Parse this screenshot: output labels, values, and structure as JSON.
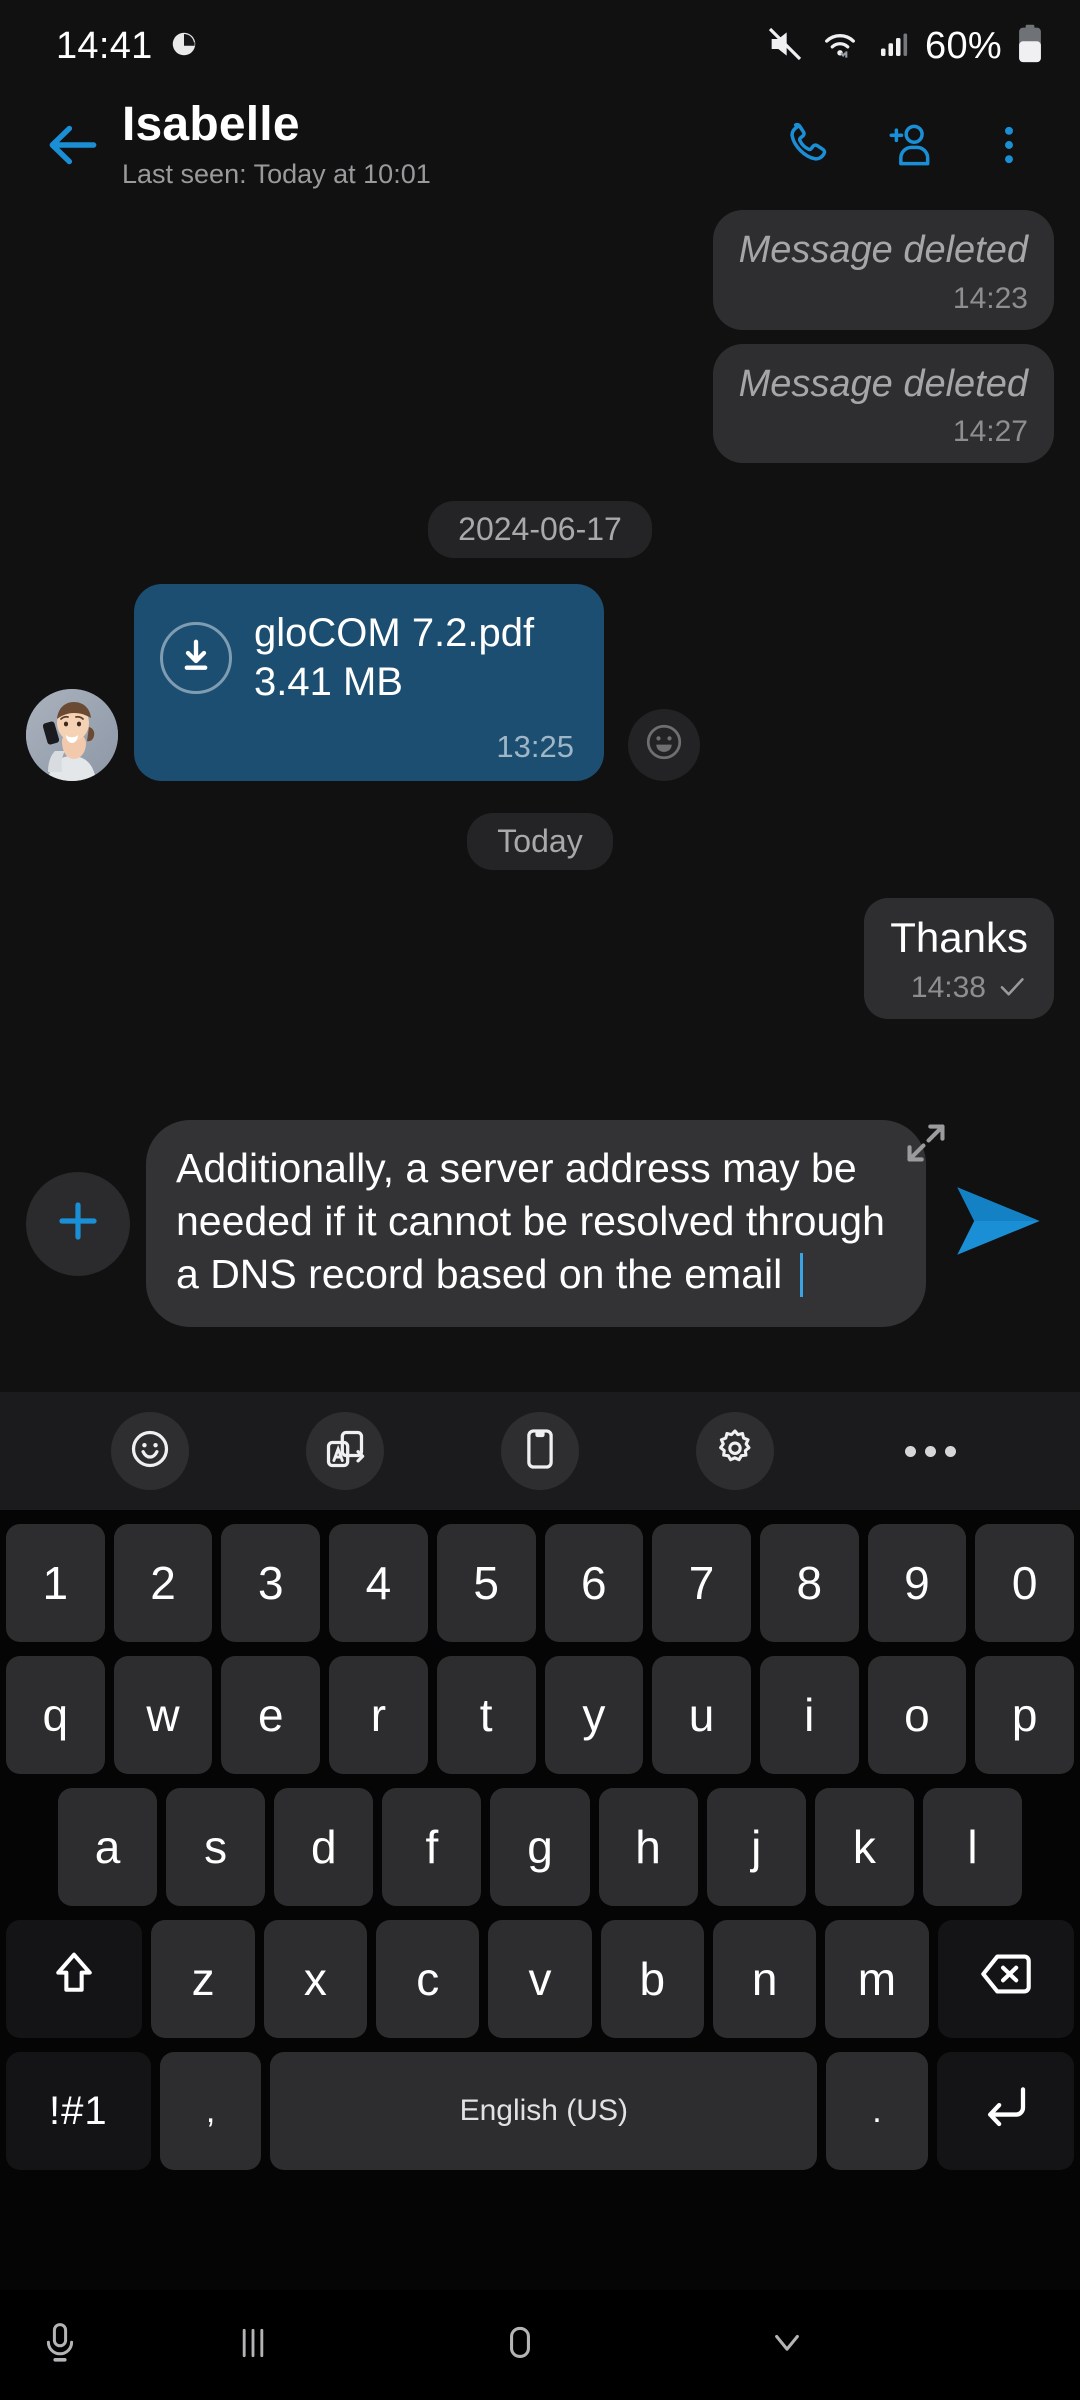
{
  "status_bar": {
    "time": "14:41",
    "left_icons": [
      "app-notification-icon"
    ],
    "right_icons": [
      "mute-icon",
      "wifi-icon",
      "signal-icon"
    ],
    "battery_percent": "60%"
  },
  "header": {
    "back_icon": "back-arrow-icon",
    "title": "Isabelle",
    "subtitle": "Last seen: Today at 10:01",
    "actions": [
      {
        "icon": "phone-icon",
        "name": "call-button"
      },
      {
        "icon": "add-person-icon",
        "name": "add-contact-button"
      },
      {
        "icon": "more-vertical-icon",
        "name": "overflow-menu-button"
      }
    ],
    "accent_color": "#1a8fd6"
  },
  "messages": [
    {
      "type": "deleted",
      "side": "out",
      "text": "Message deleted",
      "time": "14:23"
    },
    {
      "type": "deleted",
      "side": "out",
      "text": "Message deleted",
      "time": "14:27"
    },
    {
      "type": "date",
      "label": "2024-06-17"
    },
    {
      "type": "file",
      "side": "in",
      "file_name": "gloCOM 7.2.pdf",
      "file_size": "3.41 MB",
      "time": "13:25",
      "download_icon": "download-icon",
      "reaction_icon": "emoji-reaction-icon",
      "bubble_color": "#1c4e71"
    },
    {
      "type": "date",
      "label": "Today"
    },
    {
      "type": "text",
      "side": "out",
      "text": "Thanks",
      "time": "14:38",
      "status_icon": "sent-check-icon"
    }
  ],
  "composer": {
    "attach_icon": "plus-icon",
    "input_value": "Additionally, a server address may be needed if it cannot be resolved through a DNS record based on the email ",
    "expand_icon": "expand-icon",
    "send_icon": "send-icon"
  },
  "keyboard": {
    "toolbar": [
      {
        "icon": "emoji-icon",
        "name": "emoji-button"
      },
      {
        "icon": "translate-icon",
        "name": "translate-button"
      },
      {
        "icon": "clipboard-icon",
        "name": "clipboard-button"
      },
      {
        "icon": "gear-icon",
        "name": "keyboard-settings-button"
      },
      {
        "icon": "more-horizontal-icon",
        "name": "keyboard-more-button"
      }
    ],
    "rows": {
      "numbers": [
        "1",
        "2",
        "3",
        "4",
        "5",
        "6",
        "7",
        "8",
        "9",
        "0"
      ],
      "top": [
        "q",
        "w",
        "e",
        "r",
        "t",
        "y",
        "u",
        "i",
        "o",
        "p"
      ],
      "home": [
        "a",
        "s",
        "d",
        "f",
        "g",
        "h",
        "j",
        "k",
        "l"
      ],
      "bottom": [
        "z",
        "x",
        "c",
        "v",
        "b",
        "n",
        "m"
      ]
    },
    "shift_icon": "shift-icon",
    "backspace_icon": "backspace-icon",
    "symbols_label": "!#1",
    "comma_label": ",",
    "space_label": "English (US)",
    "period_label": ".",
    "enter_icon": "enter-icon"
  },
  "nav_bar": [
    {
      "icon": "microphone-icon",
      "name": "voice-input-button"
    },
    {
      "icon": "recents-icon",
      "name": "recents-button"
    },
    {
      "icon": "home-icon",
      "name": "home-button"
    },
    {
      "icon": "chevron-down-icon",
      "name": "hide-keyboard-button"
    }
  ]
}
